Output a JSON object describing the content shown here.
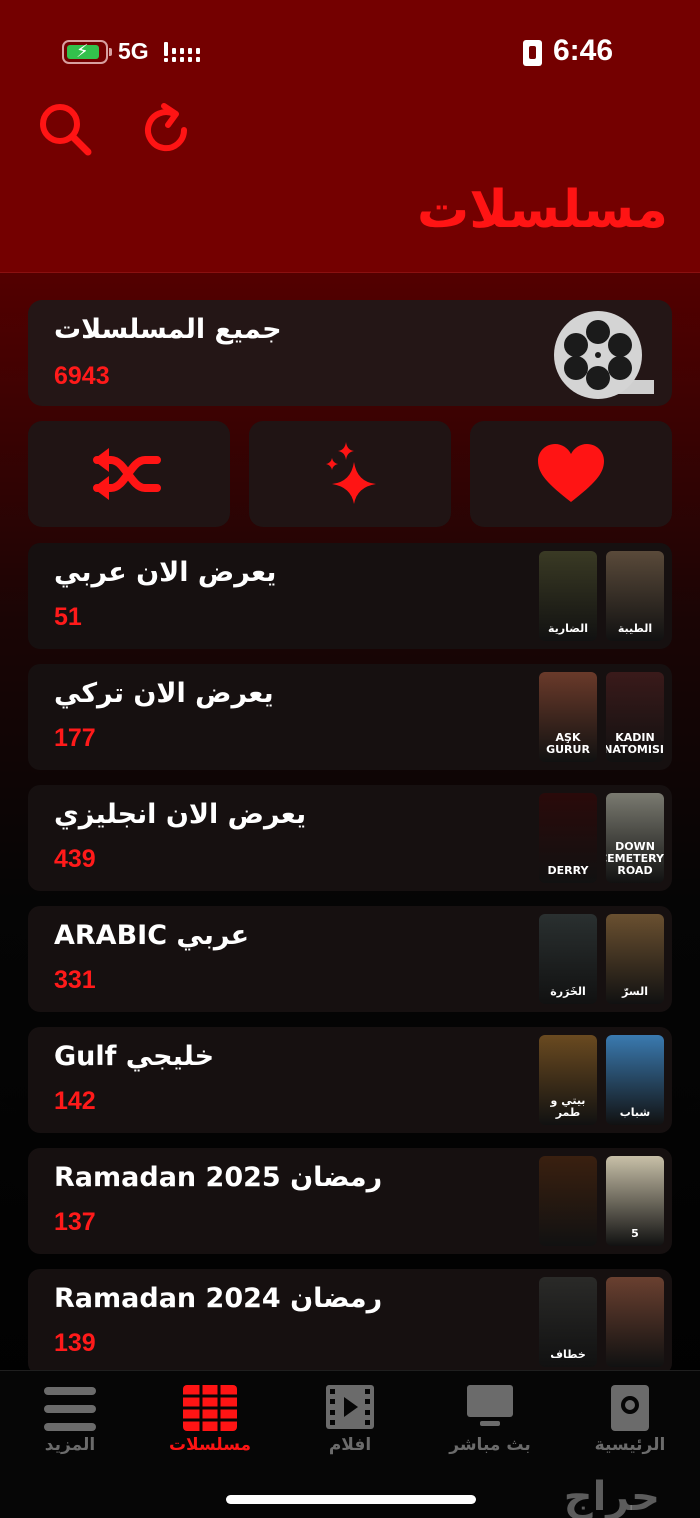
{
  "status_bar": {
    "network": "5G",
    "time": "6:46"
  },
  "header": {
    "title": "مسلسلات",
    "search_icon": "search-icon",
    "refresh_icon": "refresh-icon"
  },
  "all_series": {
    "label": "جميع المسلسلات",
    "count": "6943",
    "icon": "film-reel-icon"
  },
  "actions": [
    {
      "name": "shuffle",
      "icon": "shuffle-icon"
    },
    {
      "name": "new",
      "icon": "sparkles-icon"
    },
    {
      "name": "favorites",
      "icon": "heart-icon"
    }
  ],
  "categories": [
    {
      "label": "يعرض الان عربي",
      "count": "51",
      "posters": [
        {
          "text": "الطيبة",
          "color": "#5a4a3a"
        },
        {
          "text": "الضارية",
          "color": "#3a3a24"
        }
      ]
    },
    {
      "label": "يعرض الان تركي",
      "count": "177",
      "posters": [
        {
          "text": "KADIN ANATOMISI",
          "color": "#3a1a1a"
        },
        {
          "text": "AŞK GURUR",
          "color": "#6a3a2a"
        }
      ]
    },
    {
      "label": "يعرض الان انجليزي",
      "count": "439",
      "posters": [
        {
          "text": "DOWN CEMETERY ROAD",
          "color": "#7a7a70"
        },
        {
          "text": "DERRY",
          "color": "#2a0a0a"
        }
      ]
    },
    {
      "label": "عربي ARABIC",
      "count": "331",
      "posters": [
        {
          "text": "السرّ",
          "color": "#6a5030"
        },
        {
          "text": "الخَرَرة",
          "color": "#2a3030"
        }
      ]
    },
    {
      "label": "خليجي Gulf",
      "count": "142",
      "posters": [
        {
          "text": "شباب",
          "color": "#3a7ab0"
        },
        {
          "text": "بيتي و طمر",
          "color": "#6a4a20"
        }
      ]
    },
    {
      "label": "رمضان Ramadan 2025",
      "count": "137",
      "posters": [
        {
          "text": "5",
          "color": "#c8c0a8"
        },
        {
          "text": "",
          "color": "#3a2010"
        }
      ]
    },
    {
      "label": "رمضان Ramadan 2024",
      "count": "139",
      "posters": [
        {
          "text": "",
          "color": "#6a4030"
        },
        {
          "text": "خطاف",
          "color": "#2a2a28"
        }
      ]
    }
  ],
  "bottom_nav": [
    {
      "label": "المزيد",
      "icon": "menu-icon",
      "active": false
    },
    {
      "label": "مسلسلات",
      "icon": "grid-icon",
      "active": true
    },
    {
      "label": "افلام",
      "icon": "film-icon",
      "active": false
    },
    {
      "label": "بث مباشر",
      "icon": "tv-icon",
      "active": false
    },
    {
      "label": "الرئيسية",
      "icon": "home-icon",
      "active": false
    }
  ],
  "watermark": "حراج",
  "colors": {
    "accent": "#ff1414",
    "header_bg": "#740000"
  }
}
